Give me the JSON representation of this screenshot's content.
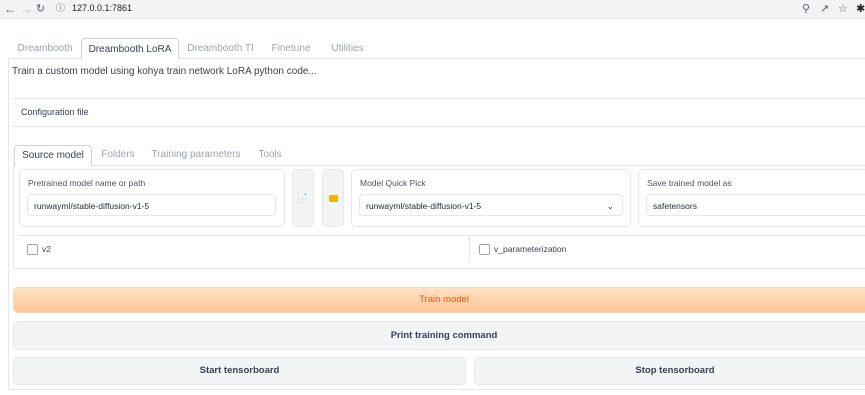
{
  "browser": {
    "url": "127.0.0.1:7861",
    "icons": [
      "back-icon",
      "forward-icon",
      "reload-icon",
      "info-icon",
      "zoom-icon",
      "share-icon",
      "star-icon",
      "pin-icon"
    ]
  },
  "tabs": [
    {
      "label": "Dreambooth",
      "active": false
    },
    {
      "label": "Dreambooth LoRA",
      "active": true
    },
    {
      "label": "Dreambooth TI",
      "active": false
    },
    {
      "label": "Finetune",
      "active": false
    },
    {
      "label": "Utilities",
      "active": false
    }
  ],
  "description": "Train a custom model using kohya train network LoRA python code...",
  "config": {
    "label": "Configuration file"
  },
  "subtabs": [
    {
      "label": "Source model",
      "active": true
    },
    {
      "label": "Folders",
      "active": false
    },
    {
      "label": "Training parameters",
      "active": false
    },
    {
      "label": "Tools",
      "active": false
    }
  ],
  "source_model": {
    "pretrained_label": "Pretrained model name or path",
    "pretrained_value": "runwayml/stable-diffusion-v1-5",
    "file_button_icon": "document-icon",
    "folder_button_icon": "folder-icon",
    "quick_pick_label": "Model Quick Pick",
    "quick_pick_value": "runwayml/stable-diffusion-v1-5",
    "save_as_label": "Save trained model as",
    "save_as_value": "safetensors",
    "v2_label": "v2",
    "v2_checked": false,
    "v_param_label": "v_parameterization",
    "v_param_checked": false
  },
  "actions": {
    "train": "Train model",
    "print": "Print training command",
    "start_tb": "Start tensorboard",
    "stop_tb": "Stop tensorboard"
  },
  "colors": {
    "primary_button": "#fdc592",
    "primary_text": "#ea580c",
    "secondary_button": "#f3f4f6",
    "folder_icon": "#f5b400"
  }
}
